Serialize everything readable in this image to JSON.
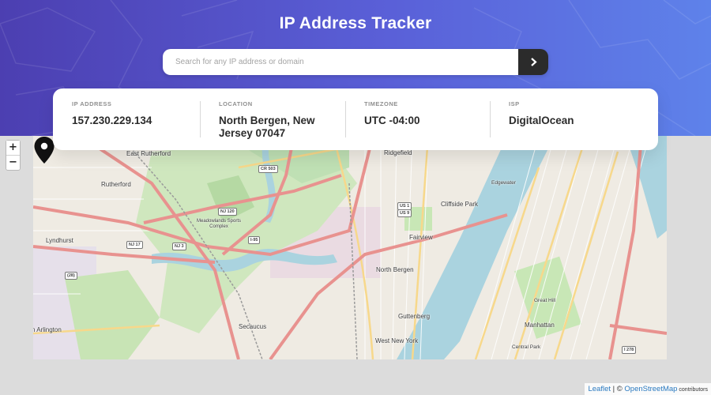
{
  "header": {
    "title": "IP Address Tracker"
  },
  "search": {
    "placeholder": "Search for any IP address or domain",
    "value": "",
    "submit_icon": "chevron-right-icon"
  },
  "info": {
    "ip": {
      "label": "IP ADDRESS",
      "value": "157.230.229.134"
    },
    "location": {
      "label": "LOCATION",
      "value": "North Bergen, New Jersey 07047"
    },
    "timezone": {
      "label": "TIMEZONE",
      "value": "UTC -04:00"
    },
    "isp": {
      "label": "ISP",
      "value": "DigitalOcean"
    }
  },
  "map": {
    "zoom_in": "+",
    "zoom_out": "−",
    "marker_icon": "location-pin-icon",
    "places": {
      "east_rutherford": "East Rutherford",
      "ridgefield": "Ridgefield",
      "rutherford": "Rutherford",
      "edgewater": "Edgewater",
      "cliffside_park": "Cliffside Park",
      "lyndhurst": "Lyndhurst",
      "meadowlands": "Meadowlands Sports Complex",
      "fairview": "Fairview",
      "north_bergen": "North Bergen",
      "secaucus": "Secaucus",
      "guttenberg": "Guttenberg",
      "west_new_york": "West New York",
      "arlington": "n Arlington",
      "manhattan": "Manhattan",
      "great_hill": "Great Hill",
      "central_park": "Central Park"
    },
    "shields": {
      "cr503": "CR 503",
      "nj120": "NJ 120",
      "us1": "US 1",
      "us9": "US 9",
      "i95": "I-95",
      "nj17": "NJ 17",
      "nj3": "NJ 3",
      "r28": "(28)",
      "i278": "I 278"
    },
    "colors": {
      "hero_gradient_start": "#4c3fb1",
      "hero_gradient_end": "#5e82ea",
      "river": "#aad3df",
      "park": "#c8e7b6",
      "highway": "#e8928f",
      "dark_button": "#2b2b2b"
    }
  },
  "attribution": {
    "leaflet": "Leaflet",
    "separator": " | © ",
    "osm": "OpenStreetMap",
    "contributors": " contributors"
  }
}
